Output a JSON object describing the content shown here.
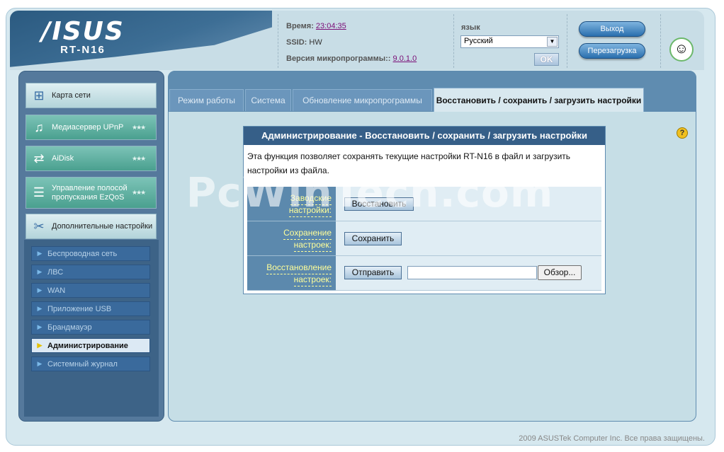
{
  "brand": {
    "logo": "/ISUS",
    "model": "RT-N16"
  },
  "status": {
    "time_label": "Время:",
    "time_value": "23:04:35",
    "ssid_label": "SSID:",
    "ssid_value": "HW",
    "fw_label": "Версия микропрограммы::",
    "fw_value": "9.0.1.0"
  },
  "language": {
    "label": "язык",
    "selected": "Русский",
    "ok_label": "OK"
  },
  "header_buttons": {
    "logout": "Выход",
    "reboot": "Перезагрузка"
  },
  "sidebar": {
    "main_items": [
      {
        "label": "Карта сети",
        "icon": "network-map-icon"
      },
      {
        "label": "Медиасервер UPnP",
        "icon": "media-server-icon"
      },
      {
        "label": "AiDisk",
        "icon": "aidisk-icon"
      },
      {
        "label": "Управление полосой пропускания EzQoS",
        "icon": "ezqos-icon"
      },
      {
        "label": "Дополнительные настройки",
        "icon": "tools-icon"
      }
    ],
    "sub_items": [
      {
        "label": "Беспроводная сеть"
      },
      {
        "label": "ЛВС"
      },
      {
        "label": "WAN"
      },
      {
        "label": "Приложение USB"
      },
      {
        "label": "Брандмауэр"
      },
      {
        "label": "Администрирование"
      },
      {
        "label": "Системный журнал"
      }
    ]
  },
  "tabs": [
    {
      "label": "Режим работы"
    },
    {
      "label": "Система"
    },
    {
      "label": "Обновление микропрограммы"
    },
    {
      "label": "Восстановить / сохранить / загрузить настройки"
    }
  ],
  "panel": {
    "title": "Администрирование - Восстановить / сохранить / загрузить настройки",
    "description": "Эта функция позволяет сохранять текущие настройки RT-N16 в файл и загрузить настройки из файла.",
    "rows": [
      {
        "label_line1": "Заводские",
        "label_line2": "настройки:",
        "button": "Восстановить"
      },
      {
        "label_line1": "Сохранение",
        "label_line2": "настроек:",
        "button": "Сохранить"
      },
      {
        "label_line1": "Восстановление",
        "label_line2": "настроек:",
        "button": "Отправить",
        "browse": "Обзор..."
      }
    ]
  },
  "watermark": "PcWinTech.com",
  "footer": "2009 ASUSTek Computer Inc. Все права защищены."
}
